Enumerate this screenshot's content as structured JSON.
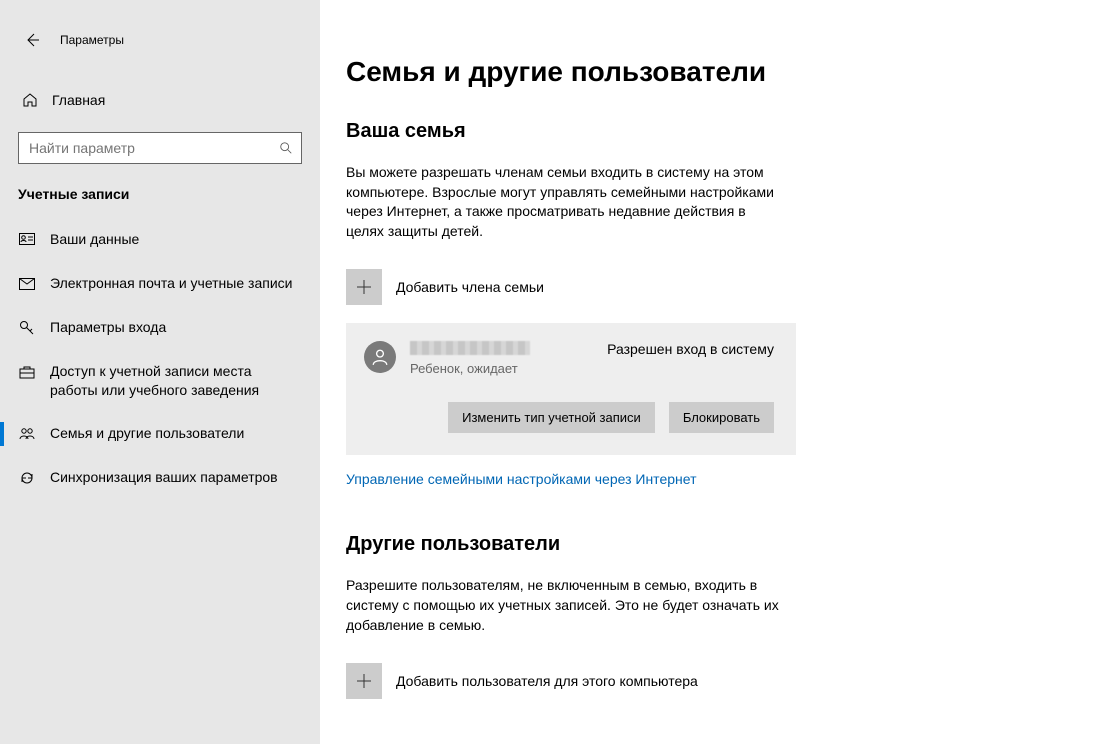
{
  "titlebar": {
    "title": "Параметры"
  },
  "sidebar": {
    "home": "Главная",
    "search_placeholder": "Найти параметр",
    "section": "Учетные записи",
    "items": [
      {
        "label": "Ваши данные"
      },
      {
        "label": "Электронная почта и учетные записи"
      },
      {
        "label": "Параметры входа"
      },
      {
        "label": "Доступ к учетной записи места работы или учебного заведения"
      },
      {
        "label": "Семья и другие пользователи"
      },
      {
        "label": "Синхронизация ваших параметров"
      }
    ]
  },
  "main": {
    "heading": "Семья и другие пользователи",
    "family": {
      "title": "Ваша семья",
      "desc": "Вы можете разрешать членам семьи входить в систему на этом компьютере. Взрослые могут управлять семейными настройками через Интернет, а также просматривать недавние действия в целях защиты детей.",
      "add_label": "Добавить члена семьи",
      "user": {
        "role": "Ребенок, ожидает",
        "status": "Разрешен вход в систему",
        "change_btn": "Изменить тип учетной записи",
        "block_btn": "Блокировать"
      },
      "manage_link": "Управление семейными настройками через Интернет"
    },
    "others": {
      "title": "Другие пользователи",
      "desc": "Разрешите пользователям, не включенным в семью, входить в систему с помощью их учетных записей. Это не будет означать их добавление в семью.",
      "add_label": "Добавить пользователя для этого компьютера"
    }
  }
}
